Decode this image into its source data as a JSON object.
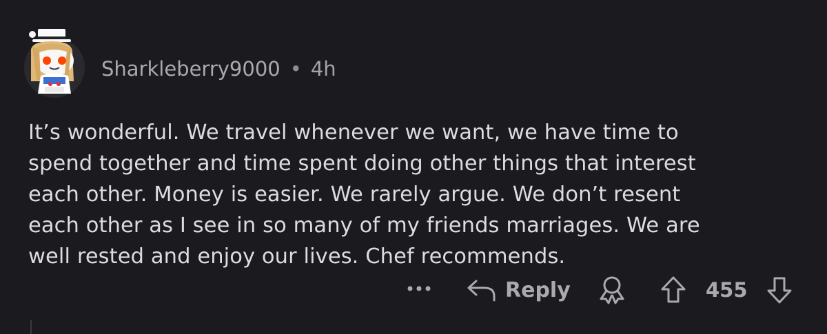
{
  "comment": {
    "username": "Sharkleberry9000",
    "separator": "•",
    "age": "4h",
    "body_lines": [
      "It’s wonderful. We travel whenever we want, we have time to",
      "spend together and time spent doing other things that interest",
      "each other. Money is easier. We rarely argue. We don’t resent",
      "each other as I see in so many of my friends marriages. We are",
      "well rested and enjoy our lives. Chef recommends."
    ]
  },
  "actions": {
    "more_icon": "more-horizontal-icon",
    "reply_icon": "reply-arrow-icon",
    "reply_label": "Reply",
    "award_icon": "award-icon",
    "upvote_icon": "upvote-arrow-icon",
    "score": "455",
    "downvote_icon": "downvote-arrow-icon"
  },
  "colors": {
    "background": "#1b1a1f",
    "text": "#dcdce0",
    "muted": "#a9a9af"
  }
}
